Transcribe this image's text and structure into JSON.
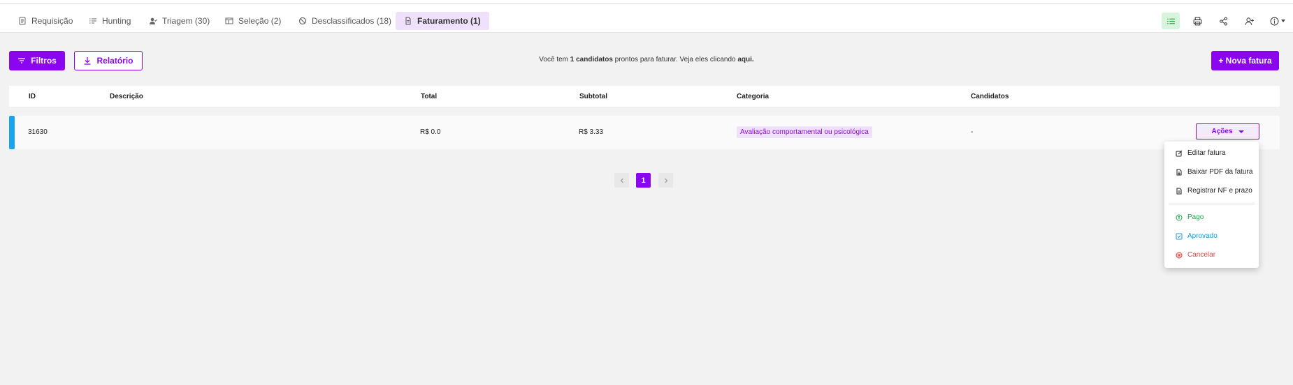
{
  "tabs": [
    {
      "label": "Requisição",
      "icon": "document-icon"
    },
    {
      "label": "Hunting",
      "icon": "list-check-icon"
    },
    {
      "label": "Triagem (30)",
      "icon": "user-check-icon"
    },
    {
      "label": "Seleção (2)",
      "icon": "table-icon"
    },
    {
      "label": "Desclassificados (18)",
      "icon": "ban-icon"
    },
    {
      "label": "Faturamento (1)",
      "icon": "invoice-icon",
      "active": true
    }
  ],
  "toolbar_icons": [
    "checklist-icon",
    "print-icon",
    "share-icon",
    "add-user-icon",
    "info-icon"
  ],
  "actions": {
    "filters_label": "Filtros",
    "report_label": "Relatório",
    "new_invoice_label": "+ Nova fatura"
  },
  "notice": {
    "prefix": "Você tem ",
    "count": "1 candidatos",
    "middle": " prontos para faturar. Veja eles clicando ",
    "link": "aqui."
  },
  "table": {
    "headers": [
      "ID",
      "Descrição",
      "Total",
      "Subtotal",
      "Categoria",
      "Candidatos"
    ],
    "rows": [
      {
        "id": "31630",
        "description": "",
        "total": "R$ 0.0",
        "subtotal": "R$ 3.33",
        "category": "Avaliação comportamental ou psicológica",
        "candidates": "-",
        "actions_label": "Ações"
      }
    ]
  },
  "dropdown": {
    "items": [
      {
        "label": "Editar fatura",
        "icon": "edit-icon"
      },
      {
        "label": "Baixar PDF da fatura",
        "icon": "pdf-download-icon"
      },
      {
        "label": "Registrar NF e prazo",
        "icon": "file-register-icon"
      }
    ],
    "status_items": [
      {
        "label": "Pago",
        "icon": "paid-icon",
        "color": "#1aab46"
      },
      {
        "label": "Aprovado",
        "icon": "approved-icon",
        "color": "#1a9ae0"
      },
      {
        "label": "Cancelar",
        "icon": "cancel-icon",
        "color": "#e04646"
      }
    ]
  },
  "pagination": {
    "current": "1"
  },
  "colors": {
    "accent": "#8a06ee",
    "row_accent": "#1aa3f0",
    "active_tab_bg": "#efe0fb"
  }
}
